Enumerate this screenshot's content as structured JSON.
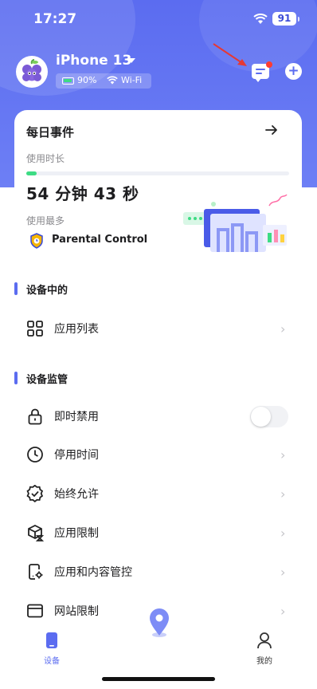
{
  "status_bar": {
    "time": "17:27",
    "battery": "91"
  },
  "device": {
    "name": "iPhone 13",
    "battery": "90%",
    "network": "Wi-Fi"
  },
  "daily_card": {
    "title": "每日事件",
    "usage_label": "使用时长",
    "usage_value": "54 分钟 43 秒",
    "usage_progress": 0.04,
    "most_used_label": "使用最多",
    "most_used_app": "Parental Control"
  },
  "sections": [
    {
      "title": "设备中的",
      "items": [
        {
          "label": "应用列表",
          "icon": "grid-icon"
        }
      ]
    },
    {
      "title": "设备监管",
      "items": [
        {
          "label": "即时禁用",
          "icon": "lock-icon",
          "toggle": false
        },
        {
          "label": "停用时间",
          "icon": "clock-icon"
        },
        {
          "label": "始终允许",
          "icon": "check-badge-icon"
        },
        {
          "label": "应用限制",
          "icon": "cube-hourglass-icon"
        },
        {
          "label": "应用和内容管控",
          "icon": "phone-gear-icon"
        },
        {
          "label": "网站限制",
          "icon": "browser-window-icon"
        }
      ]
    }
  ],
  "chevron": "›",
  "tabbar": {
    "device": "设备",
    "mine": "我的"
  },
  "colors": {
    "accent": "#5b6cf0",
    "progress": "#3ddc84",
    "badge": "#ff3b30"
  }
}
